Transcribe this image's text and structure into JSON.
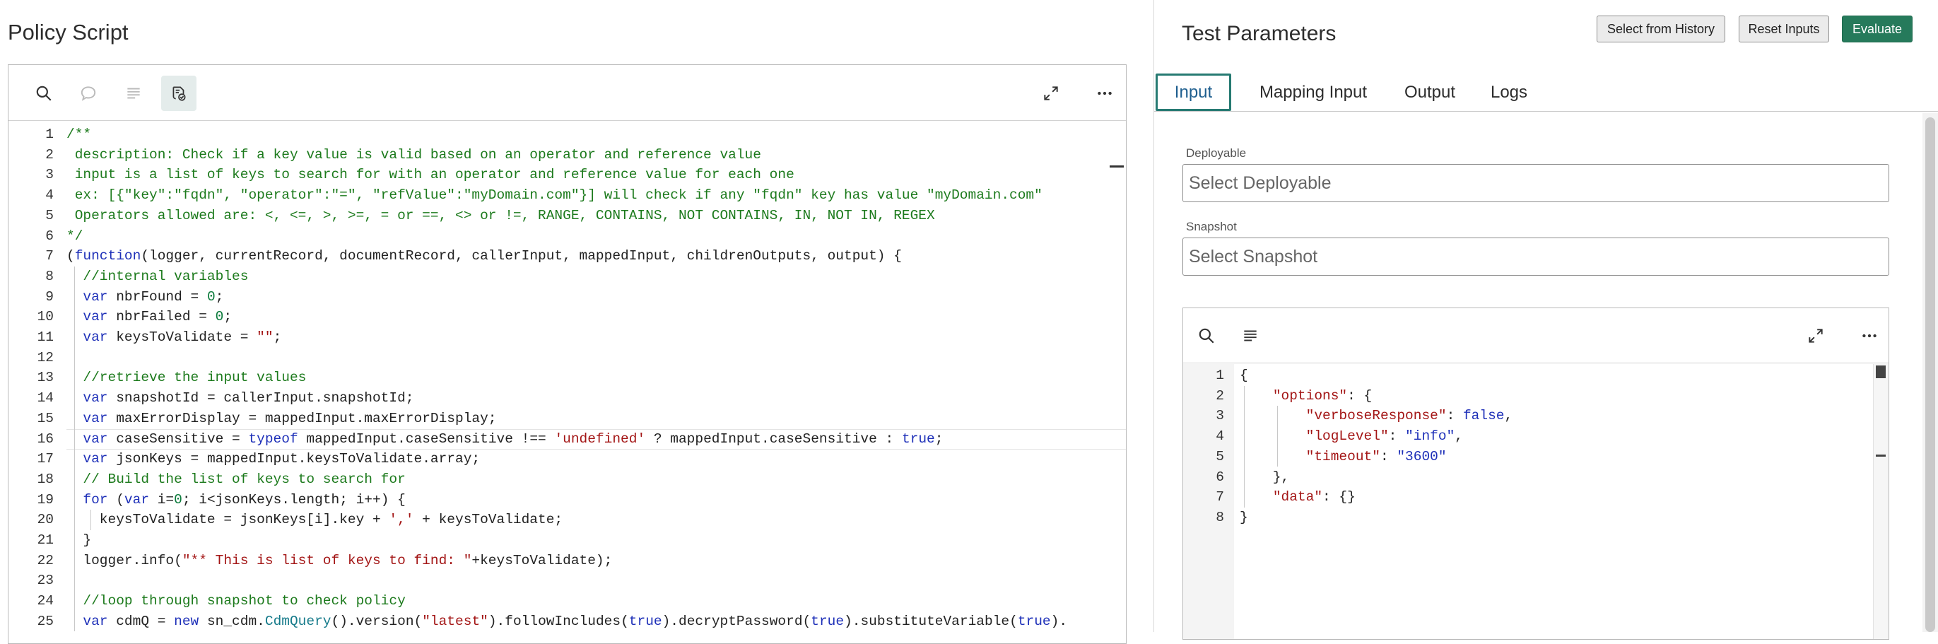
{
  "left": {
    "title": "Policy Script",
    "toolbar": {
      "search": "search-icon",
      "comment": "comment-icon",
      "format": "format-icon",
      "script": "script-check-icon",
      "expand": "expand-icon",
      "more": "more-icon"
    },
    "code_lines": [
      {
        "n": "1",
        "html": "<span class=\"c-com\">/**</span>"
      },
      {
        "n": "2",
        "html": "<span class=\"c-com\"> description: Check if a key value is valid based on an operator and reference value</span>"
      },
      {
        "n": "3",
        "html": "<span class=\"c-com\"> input is a list of keys to search for with an operator and reference value for each one</span>"
      },
      {
        "n": "4",
        "html": "<span class=\"c-com\"> ex: [{\"key\":\"fqdn\", \"operator\":\"=\", \"refValue\":\"myDomain.com\"}] will check if any \"fqdn\" key has value \"myDomain.com\"</span>"
      },
      {
        "n": "5",
        "html": "<span class=\"c-com\"> Operators allowed are: &lt;, &lt;=, &gt;, &gt;=, = or ==, &lt;&gt; or !=, RANGE, CONTAINS, NOT CONTAINS, IN, NOT IN, REGEX</span>"
      },
      {
        "n": "6",
        "html": "<span class=\"c-com\">*/</span>"
      },
      {
        "n": "7",
        "html": "(<span class=\"c-kw\">function</span>(logger, currentRecord, documentRecord, callerInput, mappedInput, childrenOutputs, output) {"
      },
      {
        "n": "8",
        "html": "  <span class=\"c-com\">//internal variables</span>"
      },
      {
        "n": "9",
        "html": "  <span class=\"c-kw\">var</span> nbrFound = <span class=\"c-num\">0</span>;"
      },
      {
        "n": "10",
        "html": "  <span class=\"c-kw\">var</span> nbrFailed = <span class=\"c-num\">0</span>;"
      },
      {
        "n": "11",
        "html": "  <span class=\"c-kw\">var</span> keysToValidate = <span class=\"c-str\">\"\"</span>;"
      },
      {
        "n": "12",
        "html": ""
      },
      {
        "n": "13",
        "html": "  <span class=\"c-com\">//retrieve the input values</span>"
      },
      {
        "n": "14",
        "html": "  <span class=\"c-kw\">var</span> snapshotId = callerInput.snapshotId;"
      },
      {
        "n": "15",
        "html": "  <span class=\"c-kw\">var</span> maxErrorDisplay = mappedInput.maxErrorDisplay;"
      },
      {
        "n": "16",
        "html": "  <span class=\"c-kw\">var</span> caseSensitive = <span class=\"c-kw\">typeof</span> mappedInput.caseSensitive !== <span class=\"c-str\">'undefined'</span> ? mappedInput.caseSensitive : <span class=\"c-kw\">true</span>;"
      },
      {
        "n": "17",
        "html": "  <span class=\"c-kw\">var</span> jsonKeys = mappedInput.keysToValidate.array;"
      },
      {
        "n": "18",
        "html": "  <span class=\"c-com\">// Build the list of keys to search for</span>"
      },
      {
        "n": "19",
        "html": "  <span class=\"c-kw\">for</span> (<span class=\"c-kw\">var</span> i=<span class=\"c-num\">0</span>; i&lt;jsonKeys.length; i++) {"
      },
      {
        "n": "20",
        "html": "    keysToValidate = jsonKeys[i].key + <span class=\"c-str\">','</span> + keysToValidate;"
      },
      {
        "n": "21",
        "html": "  }"
      },
      {
        "n": "22",
        "html": "  logger.info(<span class=\"c-str\">\"** This is list of keys to find: \"</span>+keysToValidate);"
      },
      {
        "n": "23",
        "html": ""
      },
      {
        "n": "24",
        "html": "  <span class=\"c-com\">//loop through snapshot to check policy</span>"
      },
      {
        "n": "25",
        "html": "  <span class=\"c-kw\">var</span> cdmQ = <span class=\"c-kw\">new</span> sn_cdm.<span class=\"c-type\">CdmQuery</span>().version(<span class=\"c-str\">\"latest\"</span>).followIncludes(<span class=\"c-kw\">true</span>).decryptPassword(<span class=\"c-kw\">true</span>).substituteVariable(<span class=\"c-kw\">true</span>)."
      }
    ]
  },
  "right": {
    "title": "Test Parameters",
    "buttons": {
      "history": "Select from History",
      "reset": "Reset Inputs",
      "evaluate": "Evaluate"
    },
    "tabs": [
      "Input",
      "Mapping Input",
      "Output",
      "Logs"
    ],
    "deployable": {
      "label": "Deployable",
      "placeholder": "Select Deployable"
    },
    "snapshot": {
      "label": "Snapshot",
      "placeholder": "Select Snapshot"
    },
    "json_toolbar": {
      "search": "search-icon",
      "format": "format-icon",
      "expand": "expand-icon",
      "more": "more-icon"
    },
    "json_lines": [
      {
        "n": "1",
        "html": "{"
      },
      {
        "n": "2",
        "html": "    <span class=\"j-key\">\"options\"</span>: {"
      },
      {
        "n": "3",
        "html": "        <span class=\"j-key\">\"verboseResponse\"</span>: <span class=\"j-kw\">false</span>,"
      },
      {
        "n": "4",
        "html": "        <span class=\"j-key\">\"logLevel\"</span>: <span class=\"j-str\">\"info\"</span>,"
      },
      {
        "n": "5",
        "html": "        <span class=\"j-key\">\"timeout\"</span>: <span class=\"j-str\">\"3600\"</span>"
      },
      {
        "n": "6",
        "html": "    },"
      },
      {
        "n": "7",
        "html": "    <span class=\"j-key\">\"data\"</span>: {}"
      },
      {
        "n": "8",
        "html": "}"
      }
    ]
  }
}
